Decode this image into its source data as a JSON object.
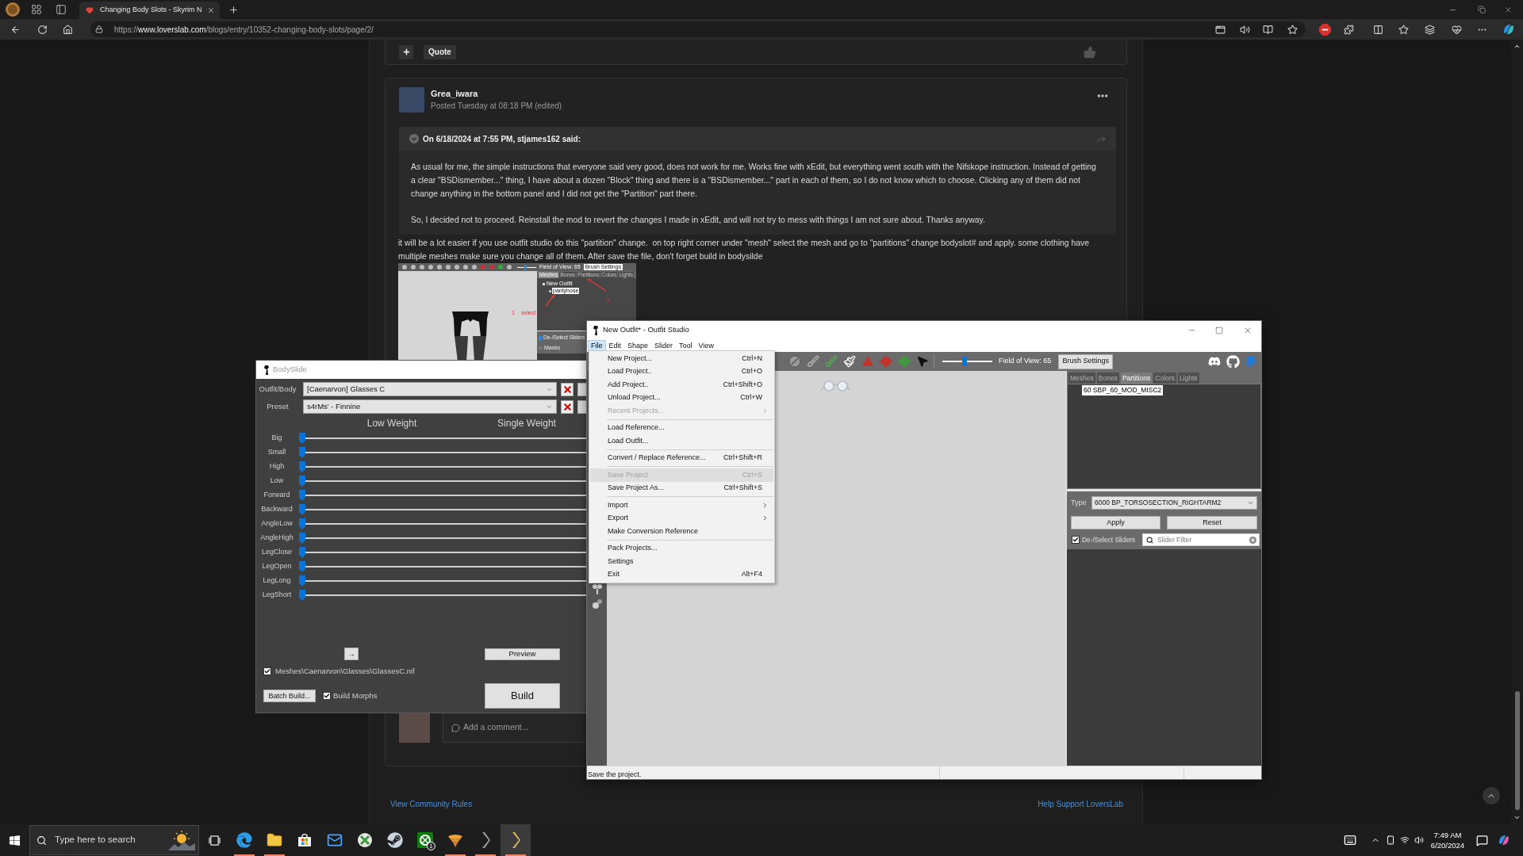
{
  "browser": {
    "tabs": [
      {
        "title": "Changing Body Slots - Skyrim N",
        "selected": true
      }
    ],
    "url": {
      "scheme": "https://",
      "domain": "www.loverslab.com",
      "path": "/blogs/entry/10352-changing-body-slots/page/2/"
    }
  },
  "top_card": {
    "quote_button": "Quote"
  },
  "post": {
    "author": "Grea_iwara",
    "posted": "Posted Tuesday at 08:18 PM (edited)",
    "quote": {
      "header": "On 6/18/2024 at 7:55 PM, stjames162 said:",
      "paragraphs": [
        "As usual for me, the simple instructions that everyone said very good, does not work for me. Works fine with xEdit, but everything went south with the Nifskope instruction. Instead of getting a clear \"BSDismember...\" thing, I have about a dozen \"Block\" thing and there is a \"BSDismember...\" part in each of them, so I do not know which to choose. Clicking any of them did not change anything in the bottom panel and I did not get the \"Partition\" part there.",
        "So, I decided not to proceed. Reinstall the mod to revert the changes I made in xEdit, and will not try to mess with things I am not sure about. Thanks anyway."
      ]
    },
    "reply": "it will be a lot easier if you use outfit studio do this \"partition\" change.  on top right corner under \"mesh\" select the mesh and go to \"partitions\" change bodyslot# and apply. some clothing have multiple meshes make sure you change all of them. After save the file, don't forget build in bodysilde",
    "screenshot": {
      "field_of_view": {
        "label": "Field of View: 65",
        "level": 0.45
      },
      "brush_settings": "Brush Settings",
      "tabs": [
        {
          "label": "Meshes",
          "selected": true
        },
        {
          "label": "Bones",
          "selected": false
        },
        {
          "label": "Partitions",
          "selected": false
        },
        {
          "label": "Colors",
          "selected": false
        },
        {
          "label": "Lights",
          "selected": false
        }
      ],
      "tree": [
        {
          "label": "New Outfit",
          "children": [
            {
              "label": "pantyhose",
              "selected": true
            }
          ]
        }
      ],
      "annotations": [
        "1",
        "select",
        "2"
      ],
      "select_sliders": {
        "label": "De-/Select Sliders",
        "checked": true
      },
      "group_label": "Masks"
    },
    "comment_placeholder": "Add a comment..."
  },
  "footer": {
    "links": [
      "View Community Rules",
      "Help Support LoversLab"
    ]
  },
  "bodyslide": {
    "title": "BodySlide",
    "outfit": {
      "label": "Outfit/Body",
      "value": "[Caenarvon] Glasses C"
    },
    "preset": {
      "label": "Preset",
      "value": "s4rMs' - Finnine"
    },
    "columns": [
      "Low Weight",
      "Single Weight"
    ],
    "sliders": [
      {
        "name": "Big",
        "level": 0
      },
      {
        "name": "Small",
        "level": 0
      },
      {
        "name": "High",
        "level": 0
      },
      {
        "name": "Low",
        "level": 0
      },
      {
        "name": "Forward",
        "level": 0
      },
      {
        "name": "Backward",
        "level": 0
      },
      {
        "name": "AngleLow",
        "level": 0
      },
      {
        "name": "AngleHigh",
        "level": 0
      },
      {
        "name": "LegClose",
        "level": 0
      },
      {
        "name": "LegOpen",
        "level": 0
      },
      {
        "name": "LegLong",
        "level": 0
      },
      {
        "name": "LegShort",
        "level": 0
      }
    ],
    "arrow_button": "→",
    "preview": "Preview",
    "file": {
      "path": "Meshes\\Caenarvon\\Glasses\\GlassesC.nif",
      "checked": true
    },
    "batch_build": "Batch Build...",
    "build_morphs": {
      "label": "Build Morphs",
      "checked": true
    },
    "build": "Build"
  },
  "outfit_studio": {
    "title": "New Outfit* - Outfit Studio",
    "menu": [
      {
        "label": "File",
        "selected": true
      },
      {
        "label": "Edit",
        "selected": false
      },
      {
        "label": "Shape",
        "selected": false
      },
      {
        "label": "Slider",
        "selected": false
      },
      {
        "label": "Tool",
        "selected": false
      },
      {
        "label": "View",
        "selected": false
      }
    ],
    "file_menu": {
      "groups": [
        {
          "items": [
            {
              "label": "New Project...",
              "shortcut": "Ctrl+N",
              "disabled": false,
              "highlighted": false,
              "submenu": false
            },
            {
              "label": "Load Project..",
              "shortcut": "Ctrl+O",
              "disabled": false,
              "highlighted": false,
              "submenu": false
            },
            {
              "label": "Add Project..",
              "shortcut": "Ctrl+Shift+O",
              "disabled": false,
              "highlighted": false,
              "submenu": false
            },
            {
              "label": "Unload Project...",
              "shortcut": "Ctrl+W",
              "disabled": false,
              "highlighted": false,
              "submenu": false
            },
            {
              "label": "Recent Projects...",
              "disabled": true,
              "highlighted": false,
              "submenu": true
            }
          ]
        },
        {
          "items": [
            {
              "label": "Load Reference...",
              "disabled": false,
              "highlighted": false,
              "submenu": false
            },
            {
              "label": "Load Outfit...",
              "disabled": false,
              "highlighted": false,
              "submenu": false
            }
          ]
        },
        {
          "items": [
            {
              "label": "Convert / Replace Reference...",
              "shortcut": "Ctrl+Shift+R",
              "disabled": false,
              "highlighted": false,
              "submenu": false
            }
          ]
        },
        {
          "items": [
            {
              "label": "Save Project",
              "shortcut": "Ctrl+S",
              "disabled": true,
              "highlighted": true,
              "submenu": false
            },
            {
              "label": "Save Project As...",
              "shortcut": "Ctrl+Shift+S",
              "disabled": false,
              "highlighted": false,
              "submenu": false
            }
          ]
        },
        {
          "items": [
            {
              "label": "Import",
              "disabled": false,
              "highlighted": false,
              "submenu": true
            },
            {
              "label": "Export",
              "disabled": false,
              "highlighted": false,
              "submenu": true
            },
            {
              "label": "Make Conversion Reference",
              "disabled": false,
              "highlighted": false,
              "submenu": false
            }
          ]
        },
        {
          "items": [
            {
              "label": "Pack Projects...",
              "disabled": false,
              "highlighted": false,
              "submenu": false
            },
            {
              "label": "Settings",
              "disabled": false,
              "highlighted": false,
              "submenu": false
            },
            {
              "label": "Exit",
              "shortcut": "Alt+F4",
              "disabled": false,
              "highlighted": false,
              "submenu": false
            }
          ]
        }
      ]
    },
    "field_of_view": {
      "label": "Field of View: 65",
      "level": 0.44
    },
    "brush_settings": "Brush Settings",
    "panel_tabs": [
      {
        "label": "Meshes",
        "selected": false
      },
      {
        "label": "Bones",
        "selected": false
      },
      {
        "label": "Partitions",
        "selected": true
      },
      {
        "label": "Colors",
        "selected": false
      },
      {
        "label": "Lights",
        "selected": false
      }
    ],
    "partitions": [
      {
        "label": "60 SBP_60_MOD_MISC2",
        "selected": true
      }
    ],
    "type": {
      "label": "Type",
      "value": "6000 BP_TORSOSECTION_RIGHTARM2"
    },
    "apply": "Apply",
    "reset": "Reset",
    "select_sliders": {
      "label": "De-/Select Sliders",
      "checked": true
    },
    "slider_filter": {
      "placeholder": "Slider Filter"
    },
    "status": "Save the project."
  },
  "taskbar": {
    "search": {
      "placeholder": "Type here to search"
    },
    "apps": [
      {
        "kind": "edge",
        "running": true,
        "active": false
      },
      {
        "kind": "explorer",
        "running": true,
        "active": false
      },
      {
        "kind": "store",
        "running": false,
        "active": false
      },
      {
        "kind": "mail",
        "running": false,
        "active": false
      },
      {
        "kind": "gamebar",
        "running": false,
        "active": false
      },
      {
        "kind": "steam",
        "running": false,
        "active": false
      },
      {
        "kind": "xbox",
        "running": false,
        "active": false,
        "badge": "1"
      },
      {
        "kind": "game",
        "running": true,
        "active": false
      },
      {
        "kind": "bodyslide",
        "running": true,
        "active": false
      },
      {
        "kind": "outfitstudio",
        "running": true,
        "active": true
      }
    ],
    "time": "7:49 AM",
    "date": "6/20/2024"
  }
}
